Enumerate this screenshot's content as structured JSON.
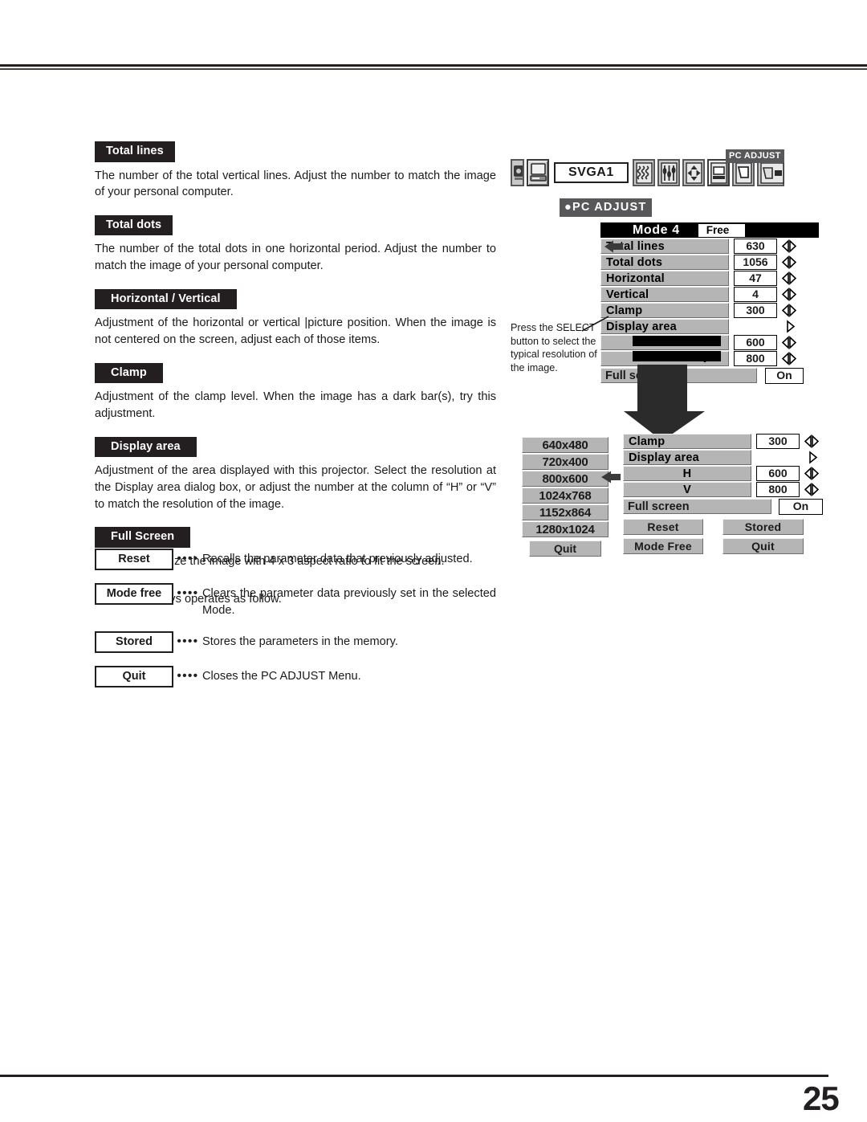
{
  "page": {
    "number": "25"
  },
  "sections": [
    {
      "id": "total-lines",
      "heading": "Total lines",
      "body": "The number of the total vertical lines.  Adjust the number to match the image of your personal computer."
    },
    {
      "id": "total-dots",
      "heading": "Total dots",
      "body": "The number of the total dots in one horizontal period.  Adjust the number to match the image of your personal computer."
    },
    {
      "id": "horizontal-vertical",
      "heading": "Horizontal / Vertical",
      "body": "Adjustment of the horizontal or vertical |picture position.  When the image is not centered on the screen, adjust each of those items."
    },
    {
      "id": "clamp",
      "heading": "Clamp",
      "body": "Adjustment of the clamp level.  When the image has a dark bar(s), try this adjustment."
    },
    {
      "id": "display-area",
      "heading": "Display area",
      "body": "Adjustment of the area displayed with this projector.  Select the resolution at the Display area dialog box, or adjust the number at the column of “H” or  “V” to match the resolution of the image."
    },
    {
      "id": "full-screen",
      "heading": "Full Screen",
      "body": "Set “On” to resize the image with 4 x 3 aspect ratio to fit the screen."
    }
  ],
  "keys_intro": "Each of the keys operates as follow.",
  "keys": [
    {
      "label": "Reset",
      "dots": "••••",
      "desc": "Recalls the parameter data that previously adjusted."
    },
    {
      "label": "Mode free",
      "dots": "••••",
      "desc": "Clears the parameter data previously set in the selected Mode."
    },
    {
      "label": "Stored",
      "dots": "••••",
      "desc": "Stores the parameters in the memory."
    },
    {
      "label": "Quit",
      "dots": "••••",
      "desc": "Closes the PC ADJUST Menu."
    }
  ],
  "osd": {
    "menubar": {
      "input_label": "SVGA1",
      "tooltip": "PC ADJUST",
      "icons": [
        "video-input-icon",
        "computer-input-icon",
        "fine-sync-icon",
        "total-dots-icon",
        "position-icon",
        "pc-adjust-icon",
        "screen-icon",
        "sound-icon"
      ]
    },
    "menu_title": "●PC  ADJUST",
    "dialog": {
      "mode_label": "Mode 4",
      "free_label": "Free",
      "rows": [
        {
          "label": "Total lines",
          "value": "630",
          "arrows": "left-right",
          "pointer": true
        },
        {
          "label": "Total dots",
          "value": "1056",
          "arrows": "left-right",
          "pointer": false
        },
        {
          "label": "Horizontal",
          "value": "47",
          "arrows": "left-right",
          "pointer": false
        },
        {
          "label": "Vertical",
          "value": "4",
          "arrows": "left-right",
          "pointer": false
        },
        {
          "label": "Clamp",
          "value": "300",
          "arrows": "left-right",
          "pointer": false
        },
        {
          "label": "Display area",
          "value": "",
          "arrows": "right",
          "pointer": false
        },
        {
          "label": "H",
          "value": "600",
          "arrows": "left-right",
          "pointer": false
        },
        {
          "label": "V",
          "value": "800",
          "arrows": "left-right",
          "pointer": false
        }
      ],
      "full_screen_label": "Full screen",
      "full_screen_value": "On"
    },
    "dialog2": {
      "rows": [
        {
          "label": "Clamp",
          "value": "300",
          "arrows": "left-right"
        },
        {
          "label": "Display area",
          "value": "",
          "arrows": "right"
        },
        {
          "label": "H",
          "value": "600",
          "arrows": "left-right"
        },
        {
          "label": "V",
          "value": "800",
          "arrows": "left-right"
        }
      ],
      "full_screen_label": "Full screen",
      "full_screen_value": "On",
      "buttons": [
        {
          "label": "Reset"
        },
        {
          "label": "Stored"
        },
        {
          "label": "Mode Free"
        },
        {
          "label": "Quit"
        }
      ]
    },
    "resolutions": {
      "items": [
        "640x480",
        "720x400",
        "800x600",
        "1024x768",
        "1152x864",
        "1280x1024"
      ],
      "selected": "800x600",
      "quit_label": "Quit"
    },
    "caption": "Press the SELECT button to select the typical resolution of the image."
  },
  "colors": {
    "menu_gray": "#b5b5b5",
    "header_black": "#000000",
    "tooltip_gray": "#58585a",
    "ink": "#231f20"
  }
}
